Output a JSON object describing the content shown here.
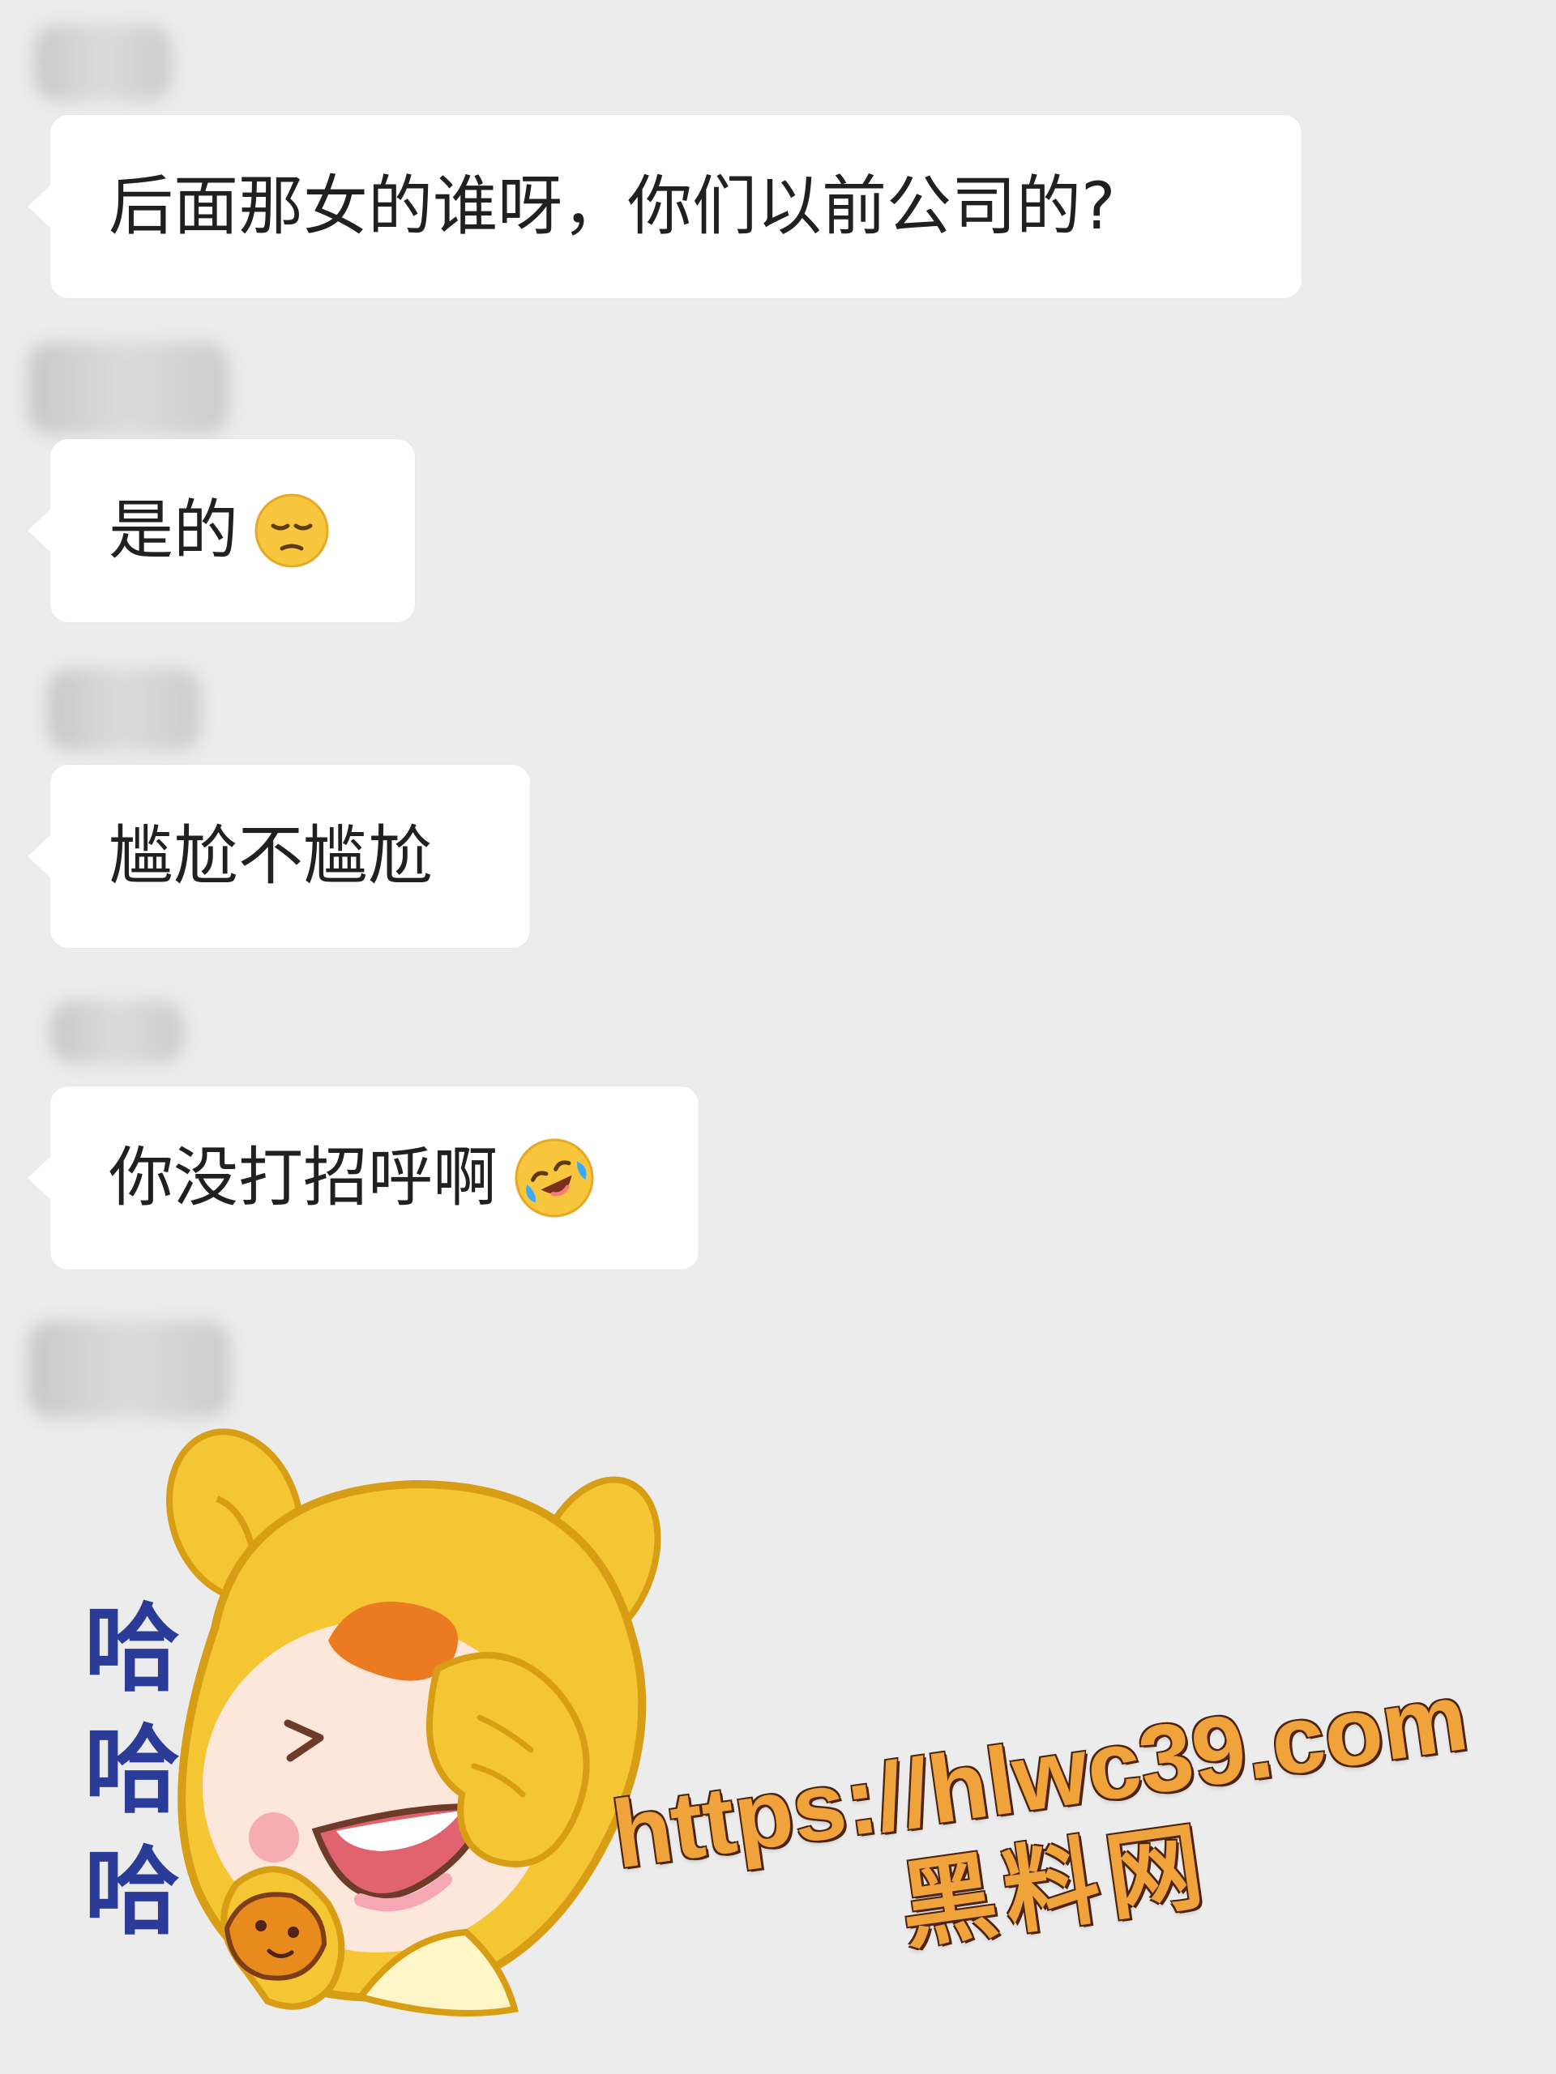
{
  "chat": {
    "messages": [
      {
        "text": "后面那女的谁呀，你们以前公司的?",
        "emoji": ""
      },
      {
        "text": "是的",
        "emoji": "pensive-face-emoji"
      },
      {
        "text": "尴尬不尴尬",
        "emoji": ""
      },
      {
        "text": "你没打招呼啊",
        "emoji": "rolling-on-floor-laughing-emoji"
      }
    ],
    "sticker": {
      "laughter": [
        "哈",
        "哈",
        "哈"
      ]
    }
  },
  "watermark": {
    "url": "https://hlwc39.com",
    "site_name": "黑料网"
  },
  "colors": {
    "chat_background": "#ececec",
    "bubble_background": "#ffffff",
    "text": "#202020",
    "laughter_text": "#2a3b98",
    "watermark": "#f0a33a"
  }
}
